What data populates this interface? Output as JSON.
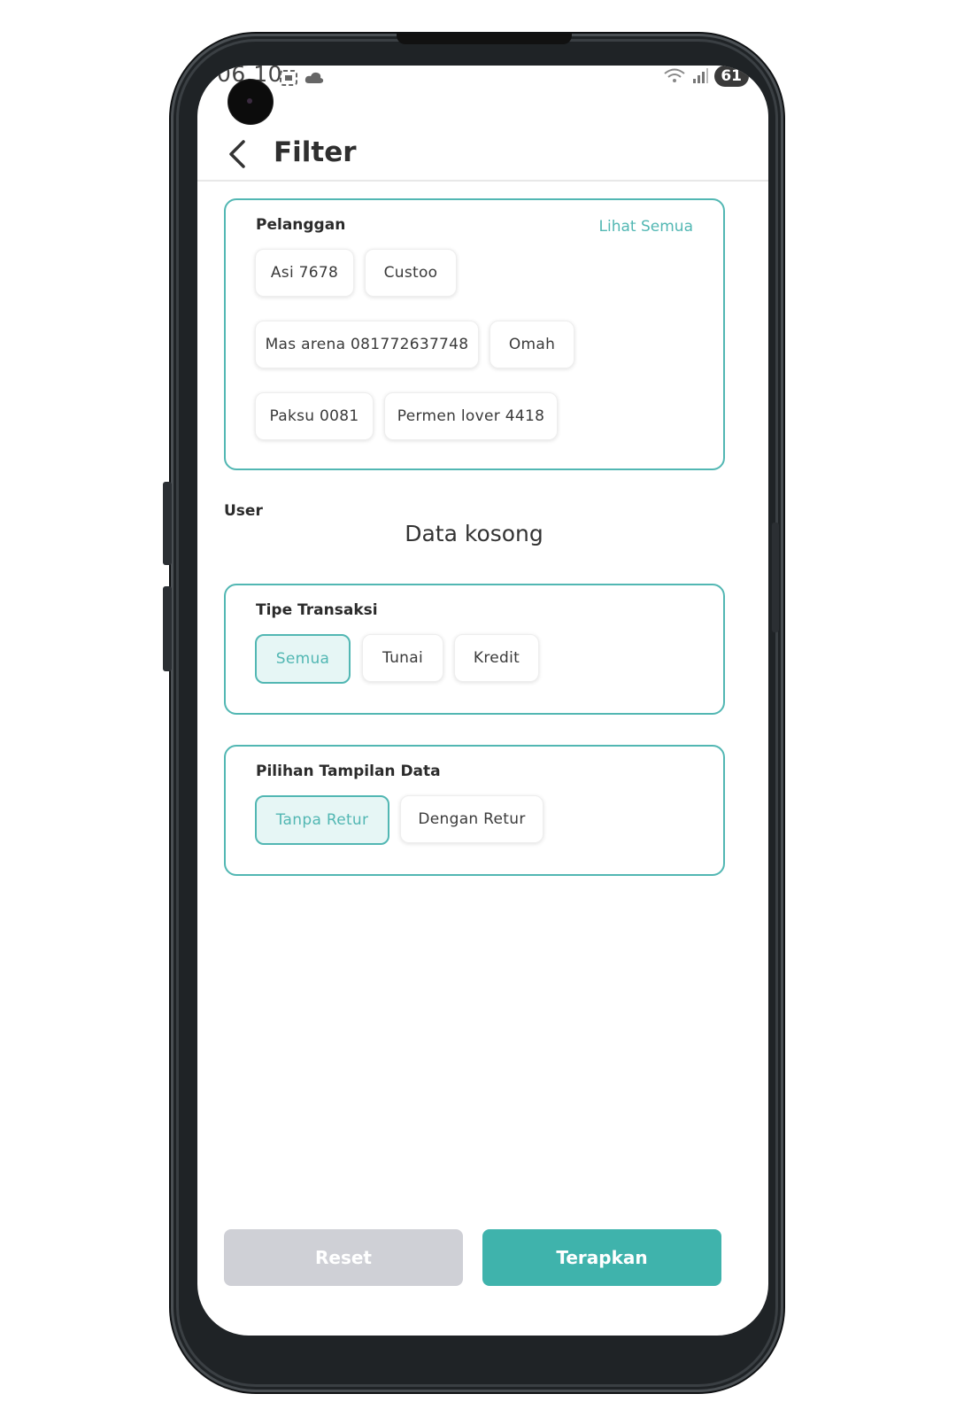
{
  "status_bar": {
    "time": "06.10",
    "battery": "61"
  },
  "header": {
    "title": "Filter"
  },
  "pelanggan": {
    "title": "Pelanggan",
    "see_all": "Lihat Semua",
    "chips": [
      "Asi 7678",
      "Custoo",
      "Mas arena 081772637748",
      "Omah",
      "Paksu 0081",
      "Permen lover 4418"
    ]
  },
  "user": {
    "label": "User",
    "empty": "Data kosong"
  },
  "tipe_transaksi": {
    "title": "Tipe Transaksi",
    "options": [
      "Semua",
      "Tunai",
      "Kredit"
    ],
    "selected": "Semua"
  },
  "pilihan_tampilan": {
    "title": "Pilihan Tampilan Data",
    "options": [
      "Tanpa Retur",
      "Dengan Retur"
    ],
    "selected": "Tanpa Retur"
  },
  "footer": {
    "reset_label": "Reset",
    "apply_label": "Terapkan"
  },
  "colors": {
    "accent": "#52b7b3",
    "apply_button": "#3fb3ac",
    "reset_button_disabled": "#cfd0d6"
  }
}
